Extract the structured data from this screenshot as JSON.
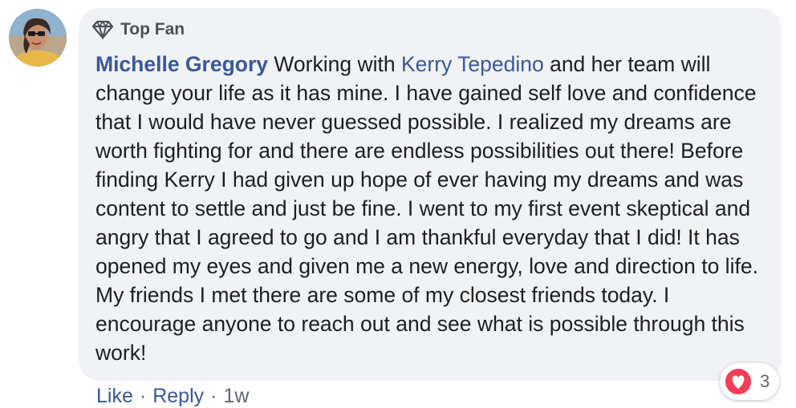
{
  "comment": {
    "badge_label": "Top Fan",
    "author": "Michelle Gregory",
    "text_before_mention": " Working with ",
    "mention": "Kerry Tepedino",
    "text_after_mention": " and her team will change your life as it has mine. I have gained self love and confidence that I would have never guessed possible. I realized my dreams are worth fighting for and there are endless possibilities out there! Before finding Kerry I had given up hope of ever having my dreams and was content to settle and just be fine. I went to my first event skeptical and angry that I agreed to go and I am thankful everyday that I did! It has opened my eyes and given me a new energy, love and direction to life. My friends I met there are some of my closest friends today. I encourage anyone to reach out and see what is possible through this work!"
  },
  "actions": {
    "like_label": "Like",
    "separator": "·",
    "reply_label": "Reply",
    "timestamp": "1w"
  },
  "reactions": {
    "icon": "love-heart-icon",
    "count": "3"
  },
  "colors": {
    "bubble_bg": "#f0f2f5",
    "link": "#385898",
    "text": "#1c1e21",
    "muted": "#606770",
    "love": "#f33e58"
  }
}
